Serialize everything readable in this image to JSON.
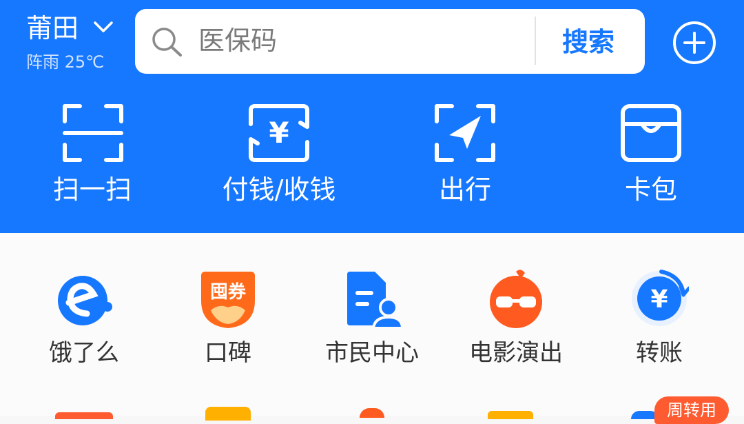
{
  "header": {
    "city": "莆田",
    "weather": "阵雨 25℃",
    "search_placeholder": "医保码",
    "search_button": "搜索"
  },
  "toolbar": {
    "scan_label": "扫一扫",
    "pay_label": "付钱/收钱",
    "travel_label": "出行",
    "wallet_label": "卡包",
    "pay_icon_symbol": "¥"
  },
  "apps": {
    "row1": {
      "eleme": "饿了么",
      "koubei": "口碑",
      "koubei_icon_text": "囤券",
      "citizen": "市民中心",
      "movie": "电影演出",
      "transfer": "转账",
      "transfer_icon_symbol": "¥"
    },
    "row2_badge": "周转用"
  },
  "colors": {
    "brand_blue": "#1677ff",
    "orange": "#ff5b30"
  }
}
